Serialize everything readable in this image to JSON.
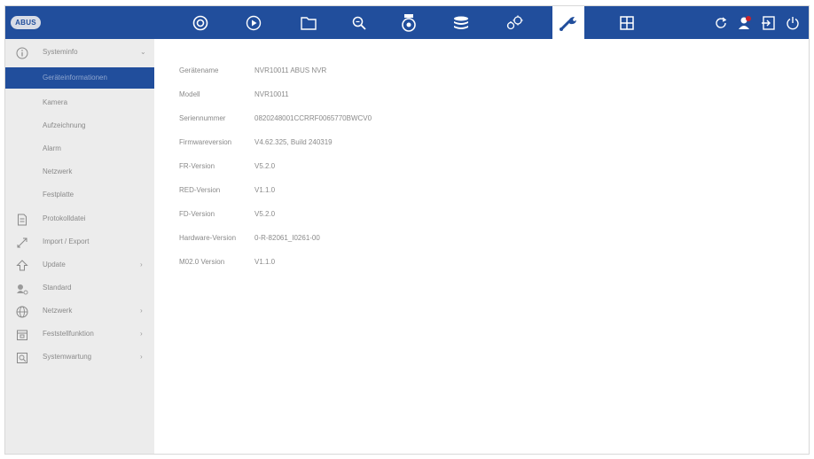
{
  "header": {
    "logo_text": "ABUS",
    "nav_icons": [
      "camera-icon",
      "playback-icon",
      "folder-icon",
      "search-icon",
      "ptz-camera-icon",
      "storage-icon",
      "gears-icon",
      "wrench-icon",
      "grid-icon"
    ],
    "active_icon": "wrench-icon",
    "right_icons": [
      "refresh-icon",
      "alarm-user-icon",
      "logout-icon",
      "power-icon"
    ],
    "accent_color": "#214e9c"
  },
  "sidebar": {
    "items": [
      {
        "label": "Systeminfo",
        "icon": "info-icon",
        "arrow": "⌄"
      },
      {
        "label": "Geräteinformationen",
        "sub": true,
        "selected": true
      },
      {
        "label": "Kamera",
        "sub": true
      },
      {
        "label": "Aufzeichnung",
        "sub": true
      },
      {
        "label": "Alarm",
        "sub": true
      },
      {
        "label": "Netzwerk",
        "sub": true
      },
      {
        "label": "Festplatte",
        "sub": true
      },
      {
        "label": "Protokolldatei",
        "icon": "document-icon"
      },
      {
        "label": "Import / Export",
        "icon": "import-export-icon"
      },
      {
        "label": "Update",
        "icon": "update-icon",
        "arrow": "›"
      },
      {
        "label": "Standard",
        "icon": "default-icon"
      },
      {
        "label": "Netzwerk",
        "icon": "globe-icon",
        "arrow": "›"
      },
      {
        "label": "Feststellfunktion",
        "icon": "calendar-icon",
        "arrow": "›"
      },
      {
        "label": "Systemwartung",
        "icon": "maintenance-icon",
        "arrow": "›"
      }
    ]
  },
  "device_info": [
    {
      "key": "Gerätename",
      "value": "NVR10011 ABUS NVR"
    },
    {
      "key": "Modell",
      "value": "NVR10011"
    },
    {
      "key": "Seriennummer",
      "value": "0820248001CCRRF0065770BWCV0"
    },
    {
      "key": "Firmwareversion",
      "value": "V4.62.325, Build 240319"
    },
    {
      "key": "FR-Version",
      "value": "V5.2.0"
    },
    {
      "key": "RED-Version",
      "value": "V1.1.0"
    },
    {
      "key": "FD-Version",
      "value": "V5.2.0"
    },
    {
      "key": "Hardware-Version",
      "value": "0-R-82061_I0261-00"
    },
    {
      "key": "M02.0 Version",
      "value": "V1.1.0"
    }
  ]
}
